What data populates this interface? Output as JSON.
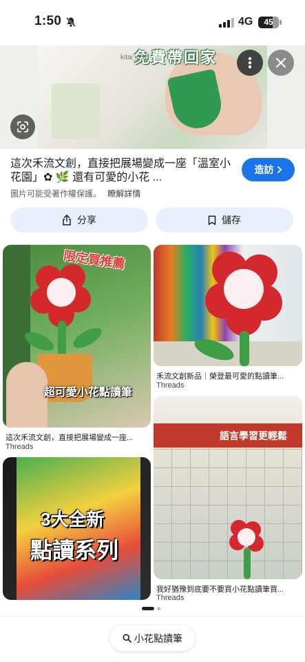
{
  "status_bar": {
    "time": "1:50",
    "network": "4G",
    "battery": "45"
  },
  "hero": {
    "caption": "免費帶回家",
    "watermark": "kitai_052"
  },
  "result": {
    "title": "這次禾流文創，直接把展場變成一座「溫室小花園」✿ 🌿 還有可愛的小花 ...",
    "disclaimer": "圖片可能受著作權保護。",
    "learn_more": "瞭解詳情",
    "visit_label": "造訪"
  },
  "actions": {
    "share": "分享",
    "save": "儲存"
  },
  "cards": [
    {
      "title": "這次禾流文創，直接把展場變成一座...",
      "source": "Threads",
      "overlay_top": "限定買推薦",
      "overlay_bottom": "超可愛小花點讀筆"
    },
    {
      "title": "禾流文創新品｜榮登最可愛的點讀筆...",
      "source": "Threads",
      "overlay_top": "",
      "overlay_bottom": ""
    },
    {
      "title": "",
      "source": "",
      "overlay_top": "3大全新",
      "overlay_bottom": "點讀系列"
    },
    {
      "title": "我好猶豫到底要不要買小花點讀筆買...",
      "source": "Threads",
      "overlay_top": "語言學習更輕鬆",
      "overlay_bottom": ""
    }
  ],
  "bottom": {
    "search_label": "小花點讀筆"
  },
  "colors": {
    "accent": "#1a73e8",
    "chip_bg": "#e8f0fe",
    "flower_red": "#d4282f"
  }
}
